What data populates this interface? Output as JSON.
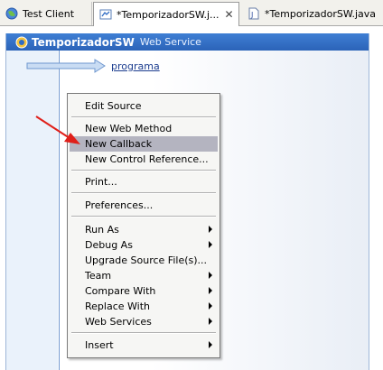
{
  "tabs": [
    {
      "label": "Test Client",
      "icon": "globe-icon"
    },
    {
      "label": "*TemporizadorSW.j...",
      "icon": "web-service-file-icon",
      "close": "✕"
    },
    {
      "label": "*TemporizadorSW.java",
      "icon": "java-file-icon"
    }
  ],
  "design": {
    "name": "TemporizadorSW",
    "type": "Web Service",
    "operation": "programa"
  },
  "menu": {
    "items": [
      {
        "label": "Edit Source"
      },
      {
        "label": "New Web Method"
      },
      {
        "label": "New Callback",
        "highlighted": true
      },
      {
        "label": "New Control Reference..."
      },
      {
        "label": "Print..."
      },
      {
        "label": "Preferences..."
      },
      {
        "label": "Run As",
        "submenu": true
      },
      {
        "label": "Debug As",
        "submenu": true
      },
      {
        "label": "Upgrade Source File(s)..."
      },
      {
        "label": "Team",
        "submenu": true
      },
      {
        "label": "Compare With",
        "submenu": true
      },
      {
        "label": "Replace With",
        "submenu": true
      },
      {
        "label": "Web Services",
        "submenu": true
      },
      {
        "label": "Insert",
        "submenu": true
      }
    ]
  },
  "colors": {
    "header": "#2f6cc4",
    "selection": "#b4b4c0",
    "annotation_arrow": "#e0201a"
  }
}
